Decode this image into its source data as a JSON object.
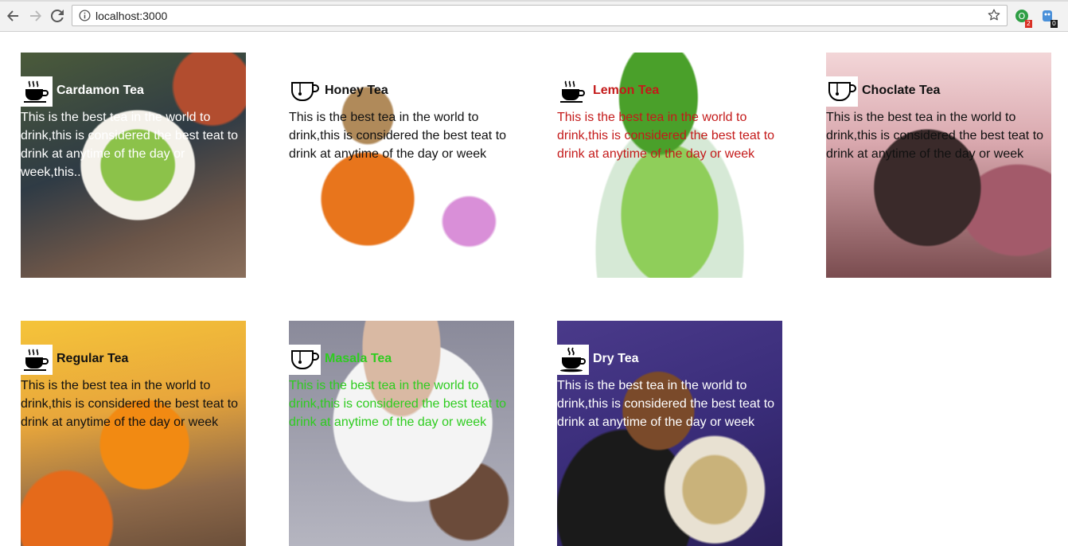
{
  "browser": {
    "url": "localhost:3000",
    "extensions": [
      {
        "name": "extension-1",
        "badge": "2",
        "badge_color": "#d93025",
        "color": "#2e9e44"
      },
      {
        "name": "extension-2",
        "badge": "0",
        "badge_color": "#1a1a1a",
        "color": "#4a90d9"
      }
    ]
  },
  "cards": [
    {
      "title": "Cardamon Tea",
      "description": "This is the best tea in the world to drink,this is considered the best teat to drink at anytime of the day or week,this..",
      "text_color": "#ffffff",
      "icon": "coffee-cup-icon"
    },
    {
      "title": "Honey Tea",
      "description": "This is the best tea in the world to drink,this is considered the best teat to drink at anytime of the day or week",
      "text_color": "#111111",
      "icon": "tea-cup-outline-icon"
    },
    {
      "title": "Lemon Tea",
      "description": "This is the best tea in the world to drink,this is considered the best teat to drink at anytime of the day or week",
      "text_color": "#c41a1a",
      "icon": "coffee-cup-icon"
    },
    {
      "title": "Choclate Tea",
      "description": "This is the best tea in the world to drink,this is considered the best teat to drink at anytime of the day or week",
      "text_color": "#111111",
      "icon": "tea-cup-outline-icon"
    },
    {
      "title": "Regular Tea",
      "description": "This is the best tea in the world to drink,this is considered the best teat to drink at anytime of the day or week",
      "text_color": "#111111",
      "icon": "coffee-cup-icon"
    },
    {
      "title": "Masala Tea",
      "description": "This is the best tea in the world to drink,this is considered the best teat to drink at anytime of the day or week",
      "text_color": "#2ecc1f",
      "icon": "tea-cup-outline-icon"
    },
    {
      "title": "Dry Tea",
      "description": "This is the best tea in the world to drink,this is considered the best teat to drink at anytime of the day or week",
      "text_color": "#ffffff",
      "icon": "steaming-cup-icon"
    }
  ]
}
